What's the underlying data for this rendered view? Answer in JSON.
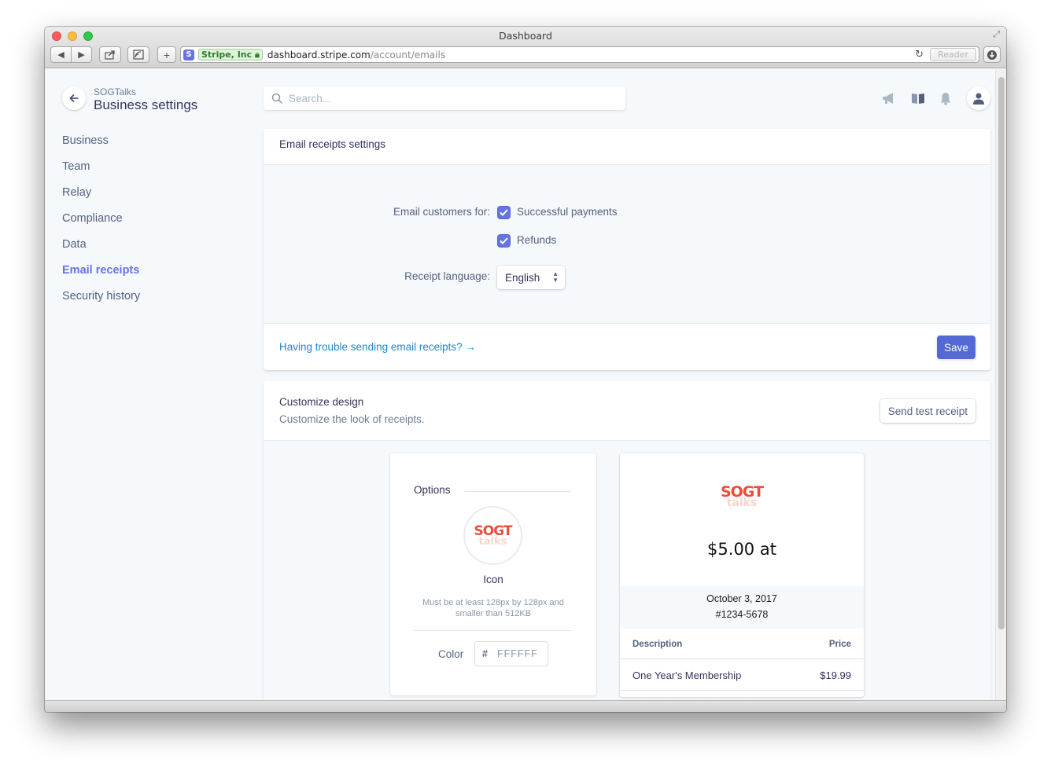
{
  "window": {
    "title": "Dashboard"
  },
  "browser": {
    "ev_badge": "Stripe, Inc",
    "url_host": "dashboard.stripe.com",
    "url_path": "/account/emails",
    "reader_label": "Reader"
  },
  "sidebar": {
    "org": "SOGTalks",
    "title": "Business settings",
    "items": [
      {
        "label": "Business"
      },
      {
        "label": "Team"
      },
      {
        "label": "Relay"
      },
      {
        "label": "Compliance"
      },
      {
        "label": "Data"
      },
      {
        "label": "Email receipts",
        "active": true
      },
      {
        "label": "Security history"
      }
    ]
  },
  "search": {
    "placeholder": "Search..."
  },
  "email_settings": {
    "title": "Email receipts settings",
    "customers_label": "Email customers for:",
    "successful_payments": "Successful payments",
    "refunds": "Refunds",
    "language_label": "Receipt language:",
    "language_value": "English",
    "trouble_link": "Having trouble sending email receipts? →",
    "save_label": "Save"
  },
  "customize": {
    "title": "Customize design",
    "subtitle": "Customize the look of receipts.",
    "test_button": "Send test receipt",
    "options": {
      "title": "Options",
      "icon_label": "Icon",
      "icon_hint": "Must be at least 128px by 128px and smaller than 512KB",
      "color_label": "Color",
      "color_hash": "#",
      "color_value": "FFFFFF"
    },
    "logo": {
      "main": "SOGT",
      "sub": "talks"
    },
    "receipt": {
      "amount": "$5.00 at",
      "date": "October 3, 2017",
      "number": "#1234-5678",
      "col_description": "Description",
      "col_price": "Price",
      "items": [
        {
          "description": "One Year's Membership",
          "price": "$19.99"
        }
      ]
    }
  },
  "colors": {
    "accent": "#6772e5",
    "save_button": "#5469d4",
    "link": "#1b89c4",
    "logo": "#ed4c3a"
  }
}
